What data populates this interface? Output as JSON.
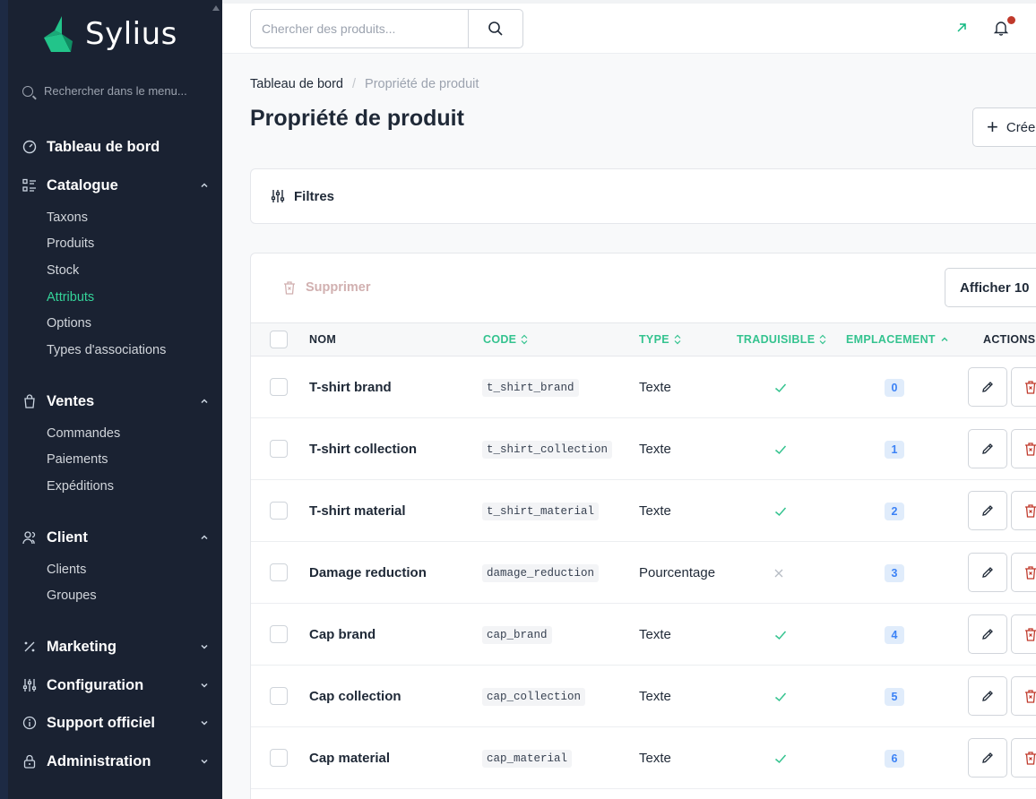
{
  "brand": {
    "name": "Sylius"
  },
  "sidebar": {
    "search_placeholder": "Rechercher dans le menu...",
    "sections": [
      {
        "label": "Tableau de bord",
        "icon": "dashboard-icon"
      },
      {
        "label": "Catalogue",
        "icon": "catalog-icon",
        "expanded": true,
        "items": [
          "Taxons",
          "Produits",
          "Stock",
          "Attributs",
          "Options",
          "Types d'associations"
        ]
      },
      {
        "label": "Ventes",
        "icon": "shopping-bag-icon",
        "expanded": true,
        "items": [
          "Commandes",
          "Paiements",
          "Expéditions"
        ]
      },
      {
        "label": "Client",
        "icon": "users-icon",
        "expanded": true,
        "items": [
          "Clients",
          "Groupes"
        ]
      },
      {
        "label": "Marketing",
        "icon": "percent-icon",
        "expanded": false
      },
      {
        "label": "Configuration",
        "icon": "sliders-icon",
        "expanded": false
      },
      {
        "label": "Support officiel",
        "icon": "info-icon",
        "expanded": false
      },
      {
        "label": "Administration",
        "icon": "lock-icon",
        "expanded": false
      }
    ],
    "active_item": "Attributs"
  },
  "topbar": {
    "search_placeholder": "Chercher des produits..."
  },
  "breadcrumb": {
    "home": "Tableau de bord",
    "separator": "/",
    "current": "Propriété de produit"
  },
  "page": {
    "title": "Propriété de produit",
    "create_label": "Crée",
    "filters_label": "Filtres",
    "bulk_delete_label": "Supprimer",
    "per_page_label": "Afficher 10"
  },
  "table": {
    "columns": {
      "name": "NOM",
      "code": "CODE",
      "type": "TYPE",
      "translatable": "TRADUISIBLE",
      "position": "EMPLACEMENT",
      "actions": "ACTIONS"
    },
    "rows": [
      {
        "name": "T-shirt brand",
        "code": "t_shirt_brand",
        "type": "Texte",
        "translatable": true,
        "position": "0"
      },
      {
        "name": "T-shirt collection",
        "code": "t_shirt_collection",
        "type": "Texte",
        "translatable": true,
        "position": "1"
      },
      {
        "name": "T-shirt material",
        "code": "t_shirt_material",
        "type": "Texte",
        "translatable": true,
        "position": "2"
      },
      {
        "name": "Damage reduction",
        "code": "damage_reduction",
        "type": "Pourcentage",
        "translatable": false,
        "position": "3"
      },
      {
        "name": "Cap brand",
        "code": "cap_brand",
        "type": "Texte",
        "translatable": true,
        "position": "4"
      },
      {
        "name": "Cap collection",
        "code": "cap_collection",
        "type": "Texte",
        "translatable": true,
        "position": "5"
      },
      {
        "name": "Cap material",
        "code": "cap_material",
        "type": "Texte",
        "translatable": true,
        "position": "6"
      }
    ]
  },
  "colors": {
    "accent": "#34c38f",
    "sidebar_bg": "#1a2232",
    "danger": "#c0392b",
    "badge_bg": "#e0ecfb",
    "badge_text": "#3b82f6"
  }
}
